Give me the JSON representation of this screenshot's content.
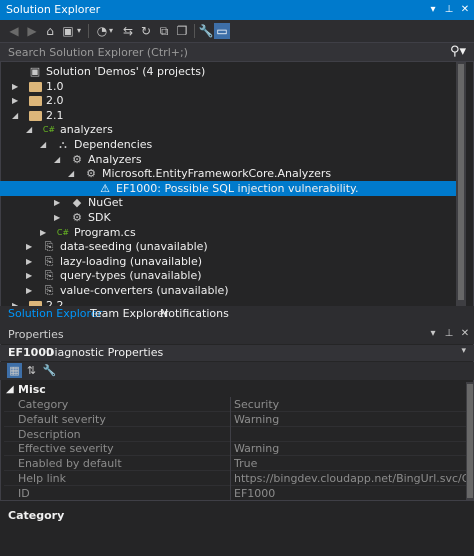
{
  "solution_explorer": {
    "title": "Solution Explorer",
    "pin_icon": "pin-icon",
    "close_icon": "close-icon",
    "search_placeholder": "Search Solution Explorer (Ctrl+;)",
    "tree": [
      {
        "label": "Solution 'Demos' (4 projects)",
        "level": 0,
        "expander": "",
        "icon": "solution-icon"
      },
      {
        "label": "1.0",
        "level": 0,
        "expander": "▶",
        "icon": "folder-icon"
      },
      {
        "label": "2.0",
        "level": 0,
        "expander": "▶",
        "icon": "folder-icon"
      },
      {
        "label": "2.1",
        "level": 0,
        "expander": "◢",
        "icon": "folder-open-icon"
      },
      {
        "label": "analyzers",
        "level": 1,
        "expander": "◢",
        "icon": "csharp-project-icon"
      },
      {
        "label": "Dependencies",
        "level": 2,
        "expander": "◢",
        "icon": "dependencies-icon"
      },
      {
        "label": "Analyzers",
        "level": 3,
        "expander": "◢",
        "icon": "analyzers-icon"
      },
      {
        "label": "Microsoft.EntityFrameworkCore.Analyzers",
        "level": 4,
        "expander": "◢",
        "icon": "analyzer-package-icon"
      },
      {
        "label": "EF1000: Possible SQL injection vulnerability.",
        "level": 5,
        "expander": "",
        "icon": "warning-icon",
        "selected": true
      },
      {
        "label": "NuGet",
        "level": 3,
        "expander": "▶",
        "icon": "nuget-icon"
      },
      {
        "label": "SDK",
        "level": 3,
        "expander": "▶",
        "icon": "sdk-icon"
      },
      {
        "label": "Program.cs",
        "level": 2,
        "expander": "▶",
        "icon": "csharp-file-icon"
      },
      {
        "label": "data-seeding (unavailable)",
        "level": 1,
        "expander": "▶",
        "icon": "unavailable-project-icon"
      },
      {
        "label": "lazy-loading (unavailable)",
        "level": 1,
        "expander": "▶",
        "icon": "unavailable-project-icon"
      },
      {
        "label": "query-types (unavailable)",
        "level": 1,
        "expander": "▶",
        "icon": "unavailable-project-icon"
      },
      {
        "label": "value-converters (unavailable)",
        "level": 1,
        "expander": "▶",
        "icon": "unavailable-project-icon"
      },
      {
        "label": "2.2",
        "level": 0,
        "expander": "▶",
        "icon": "folder-icon"
      }
    ],
    "tabs": [
      "Solution Explorer",
      "Team Explorer",
      "Notifications"
    ]
  },
  "properties": {
    "title": "Properties",
    "object_name": "EF1000",
    "object_type": "Diagnostic Properties",
    "category": "Misc",
    "rows": [
      {
        "key": "Category",
        "value": "Security"
      },
      {
        "key": "Default severity",
        "value": "Warning"
      },
      {
        "key": "Description",
        "value": ""
      },
      {
        "key": "Effective severity",
        "value": "Warning"
      },
      {
        "key": "Enabled by default",
        "value": "True"
      },
      {
        "key": "Help link",
        "value": "https://bingdev.cloudapp.net/BingUrl.svc/Get?selectedSea"
      },
      {
        "key": "ID",
        "value": "EF1000"
      }
    ],
    "description_title": "Category"
  },
  "colors": {
    "accent": "#007acc",
    "background": "#252526",
    "chrome": "#2d2d30"
  }
}
